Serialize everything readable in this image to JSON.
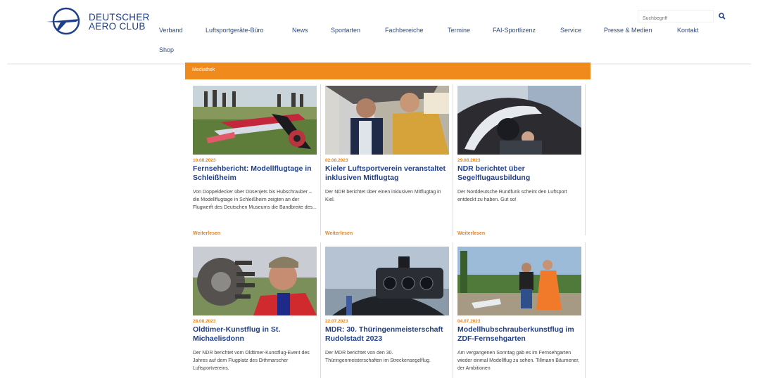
{
  "brand": {
    "line1": "DEUTSCHER",
    "line2": "AERO CLUB",
    "color": "#1f3f8c"
  },
  "nav": {
    "items": [
      "Verband",
      "Luftsportgeräte-Büro",
      "News",
      "Sportarten",
      "Fachbereiche",
      "Termine",
      "FAI-Sportlizenz",
      "Service",
      "Presse & Medien",
      "Kontakt"
    ],
    "shop": "Shop"
  },
  "search": {
    "placeholder": "Suchbegriff",
    "icon": "search-icon"
  },
  "banner": {
    "label": "Mediathek",
    "color": "#f08a1c"
  },
  "cards": [
    {
      "date": "10.08.2023",
      "title": "Fernsehbericht: Modellflugtage in Schleißheim",
      "text": "Von Doppeldecker über Düsenjets bis Hubschrauber – die Modellflugtage in Schleißheim zeigten an der Flugwerft des Deutschen Museums die Bandbreite des...",
      "more": "Weiterlesen"
    },
    {
      "date": "02.08.2023",
      "title": "Kieler Luftsportverein veranstaltet inklusiven Mitflugtag",
      "text": "Der NDR berichtet über einen inklusiven Mitflugtag in Kiel.",
      "more": "Weiterlesen"
    },
    {
      "date": "29.08.2023",
      "title": "NDR berichtet über Segelflugausbildung",
      "text": "Der Norddeutsche Rundfunk scheint den Luftsport entdeckt zu haben. Gut so!",
      "more": "Weiterlesen"
    },
    {
      "date": "28.08.2023",
      "title": "Oldtimer-Kunstflug in St. Michaelisdonn",
      "text": "Der NDR berichtet vom Oldtimer-Kunstflug-Event des Jahres auf dem Flugplatz des Dithmarscher Luftsportvereins."
    },
    {
      "date": "22.07.2023",
      "title": "MDR: 30. Thüringenmeisterschaft Rudolstadt 2023",
      "text": "Der MDR berichtet von den 30. Thüringenmeisterschaften im Streckensegelflug."
    },
    {
      "date": "04.07.2023",
      "title": "Modellhubschrauberkunstflug im ZDF-Fernsehgarten",
      "text": "Am vergangenen Sonntag gab es im Fernsehgarten wieder einmal Modellflug zu sehen. Tillmann Bäumener, der Ambitionen"
    }
  ]
}
